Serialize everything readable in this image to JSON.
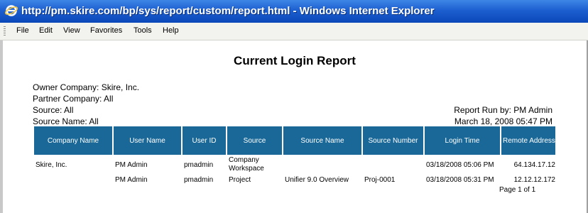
{
  "window": {
    "title": "http://pm.skire.com/bp/sys/report/custom/report.html - Windows Internet Explorer"
  },
  "menu": [
    "File",
    "Edit",
    "View",
    "Favorites",
    "Tools",
    "Help"
  ],
  "report": {
    "title": "Current Login Report",
    "owner_company": "Owner Company: Skire, Inc.",
    "partner_company": "Partner Company: All",
    "source": "Source: All",
    "source_name": "Source Name: All",
    "run_by": "Report Run by: PM Admin",
    "run_date": "March 18, 2008 05:47 PM",
    "columns": [
      "Company Name",
      "User Name",
      "User ID",
      "Source",
      "Source Name",
      "Source Number",
      "Login Time",
      "Remote Address"
    ],
    "rows": [
      {
        "company": "Skire, Inc.",
        "user_name": "PM Admin",
        "user_id": "pmadmin",
        "source": "Company Workspace",
        "source_name": "",
        "source_number": "",
        "login_time": "03/18/2008 05:06 PM",
        "remote_address": "64.134.17.12"
      },
      {
        "company": "",
        "user_name": "PM Admin",
        "user_id": "pmadmin",
        "source": "Project",
        "source_name": "Unifier 9.0 Overview",
        "source_number": "Proj-0001",
        "login_time": "03/18/2008 05:31 PM",
        "remote_address": "12.12.12.172"
      }
    ],
    "page_info": "Page 1 of 1"
  },
  "colors": {
    "header_bg": "#1a6898",
    "titlebar": "#1d5fd0"
  }
}
